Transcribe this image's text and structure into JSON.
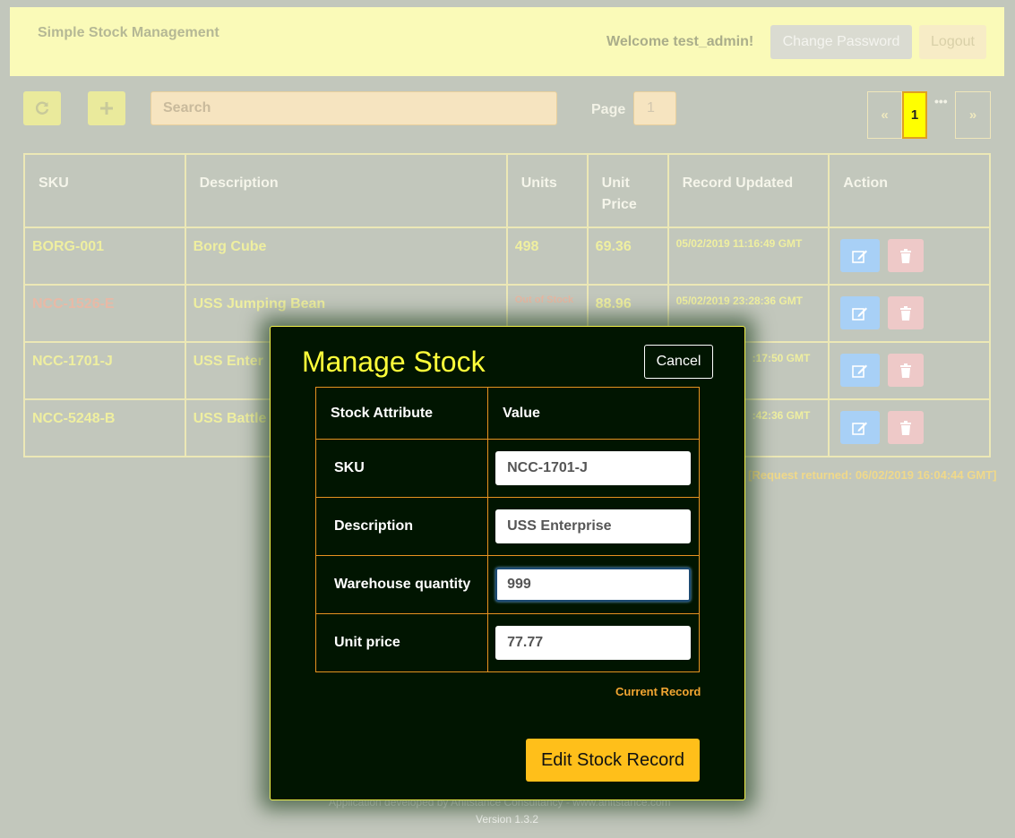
{
  "header": {
    "title": "Simple Stock Management",
    "welcome": "Welcome test_admin!",
    "change_password": "Change Password",
    "logout": "Logout"
  },
  "toolbar": {
    "search_placeholder": "Search",
    "page_label": "Page",
    "page_value": "1"
  },
  "pagination": {
    "prev": "«",
    "current": "1",
    "more": "•••",
    "next": "»"
  },
  "table": {
    "headers": [
      "SKU",
      "Description",
      "Units",
      "Unit Price",
      "Record Updated",
      "Action"
    ],
    "rows": [
      {
        "sku": "BORG-001",
        "description": "Borg Cube",
        "units": "498",
        "price": "69.36",
        "updated": "05/02/2019 11:16:49 GMT"
      },
      {
        "sku": "NCC-1526-E",
        "description": "USS Jumping Bean",
        "units": "Out of Stock",
        "price": "88.96",
        "updated": "05/02/2019 23:28:36 GMT"
      },
      {
        "sku": "NCC-1701-J",
        "description": "USS Enter",
        "units": "",
        "price": "",
        "updated": ":17:50 GMT"
      },
      {
        "sku": "NCC-5248-B",
        "description": "USS Battle",
        "units": "",
        "price": "",
        "updated": ":42:36 GMT"
      }
    ]
  },
  "request_returned": "[Request returned: 06/02/2019 16:04:44 GMT]",
  "footer": {
    "credit": "Application developed by Anitstance Consultancy - www.anitstance.com",
    "version": "Version 1.3.2"
  },
  "modal": {
    "title": "Manage Stock",
    "cancel": "Cancel",
    "col_attr": "Stock Attribute",
    "col_value": "Value",
    "fields": [
      {
        "label": "SKU",
        "value": "NCC-1701-J"
      },
      {
        "label": "Description",
        "value": "USS Enterprise"
      },
      {
        "label": "Warehouse quantity",
        "value": "999"
      },
      {
        "label": "Unit price",
        "value": "77.77"
      }
    ],
    "current_record": "Current Record",
    "submit": "Edit Stock Record"
  },
  "colors": {
    "header_bg": "#fafab8",
    "modal_bg": "#011501",
    "modal_title": "#ffff3a",
    "submit_bg": "#ffbf1a",
    "page_current": "#ffff00"
  },
  "icons": [
    "refresh-icon",
    "plus-icon",
    "edit-icon",
    "trash-icon",
    "ellipsis-icon"
  ]
}
